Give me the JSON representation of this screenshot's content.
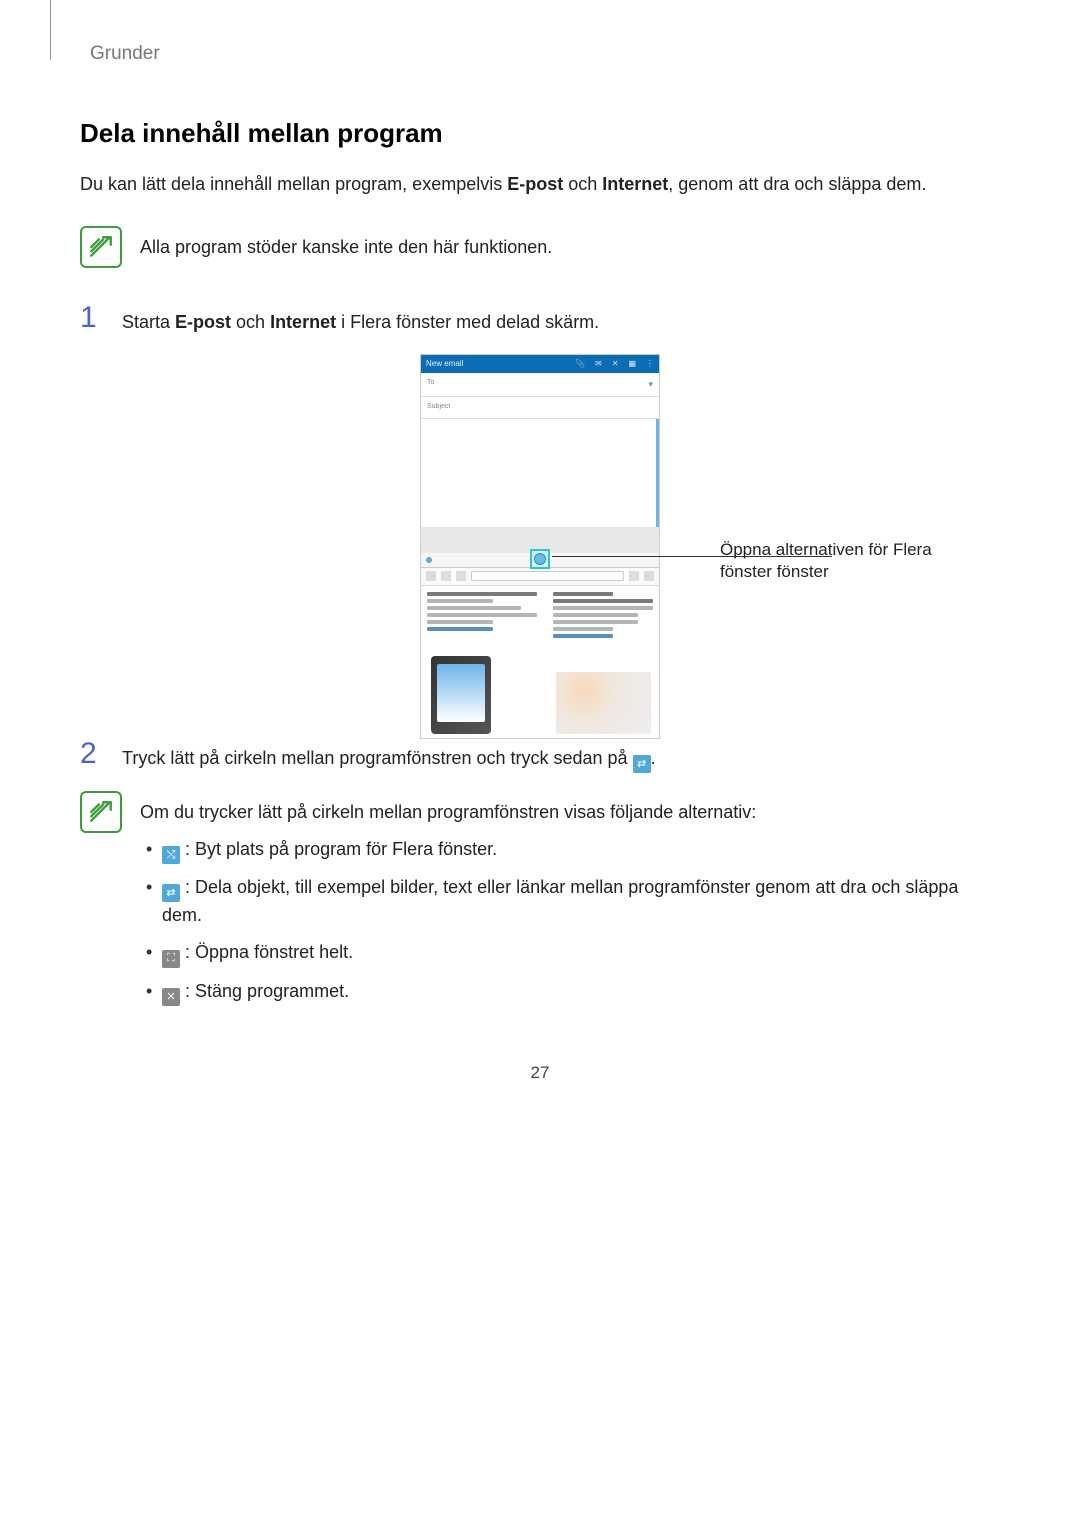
{
  "header": {
    "section": "Grunder"
  },
  "heading": "Dela innehåll mellan program",
  "intro": {
    "part1": "Du kan lätt dela innehåll mellan program, exempelvis ",
    "bold1": "E-post",
    "mid": " och ",
    "bold2": "Internet",
    "part2": ", genom att dra och släppa dem."
  },
  "note1": "Alla program stöder kanske inte den här funktionen.",
  "step1": {
    "num": "1",
    "pre": "Starta ",
    "b1": "E-post",
    "mid": " och ",
    "b2": "Internet",
    "post": " i Flera fönster med delad skärm."
  },
  "mock": {
    "title": "New email",
    "to": "To",
    "subject": "Subject"
  },
  "callout": "Öppna alternativen för Flera fönster fönster",
  "step2": {
    "num": "2",
    "text": "Tryck lätt på cirkeln mellan programfönstren och tryck sedan på ",
    "after": "."
  },
  "note2": {
    "intro": "Om du trycker lätt på cirkeln mellan programfönstren visas följande alternativ:",
    "items": [
      ": Byt plats på program för Flera fönster.",
      ": Dela objekt, till exempel bilder, text eller länkar mellan programfönster genom att dra och släppa dem.",
      ": Öppna fönstret helt.",
      ": Stäng programmet."
    ]
  },
  "pageNumber": "27"
}
